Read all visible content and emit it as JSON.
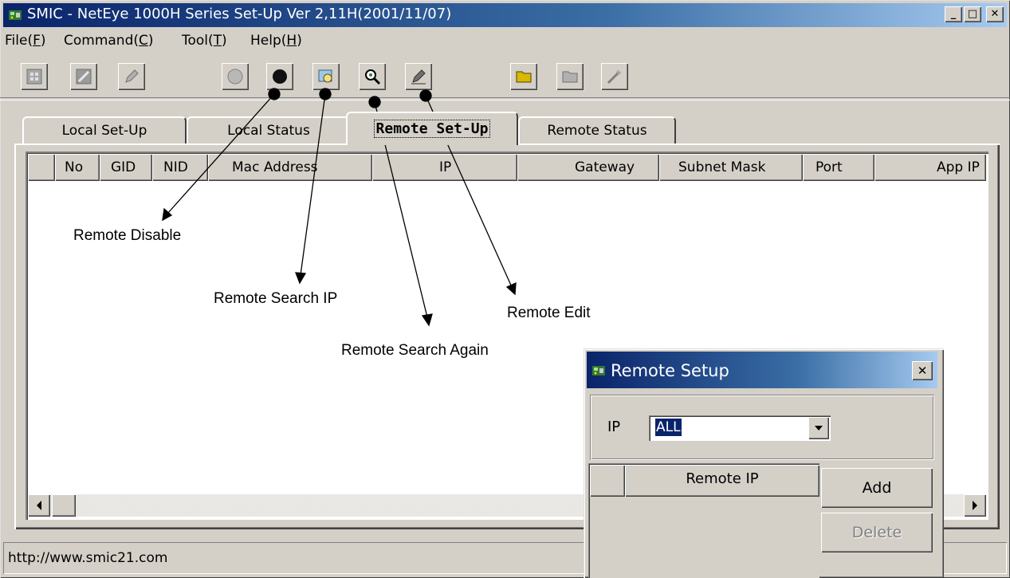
{
  "window": {
    "title": "SMIC - NetEye 1000H Series Set-Up Ver 2,11H(2001/11/07)",
    "controls": {
      "minimize": "_",
      "maximize": "□",
      "close": "✕"
    }
  },
  "menu": [
    {
      "pre": "File(",
      "key": "F",
      "post": ")"
    },
    {
      "pre": "Command(",
      "key": "C",
      "post": ")"
    },
    {
      "pre": "Tool(",
      "key": "T",
      "post": ")"
    },
    {
      "pre": "Help(",
      "key": "H",
      "post": ")"
    }
  ],
  "toolbar_icons": [
    "local-grid-icon",
    "local-panel-icon",
    "local-pencil-icon",
    "remote-enable-icon",
    "remote-disable-icon",
    "remote-search-ip-icon",
    "remote-search-again-icon",
    "remote-edit-icon",
    "folder-open-icon",
    "folder-icon",
    "wand-icon"
  ],
  "tabs": [
    {
      "label": "Local Set-Up",
      "active": false
    },
    {
      "label": "Local Status",
      "active": false
    },
    {
      "label": "Remote Set-Up",
      "active": true
    },
    {
      "label": "Remote Status",
      "active": false
    }
  ],
  "table": {
    "columns": [
      "",
      "No",
      "GID",
      "NID",
      "Mac Address",
      "IP",
      "Gateway",
      "Subnet Mask",
      "Port",
      "App IP"
    ]
  },
  "annotations": {
    "remote_disable": "Remote Disable",
    "remote_search_ip": "Remote Search IP",
    "remote_search_again": "Remote Search Again",
    "remote_edit": "Remote Edit"
  },
  "status": {
    "text": "http://www.smic21.com"
  },
  "dialog": {
    "title": "Remote Setup",
    "ip_label": "IP",
    "ip_value": "ALL",
    "list_header": "Remote IP",
    "add_label": "Add",
    "delete_label": "Delete"
  },
  "colors": {
    "titlebar_start": "#0a246a",
    "titlebar_end": "#a6caf0",
    "face": "#d4d0c8"
  }
}
